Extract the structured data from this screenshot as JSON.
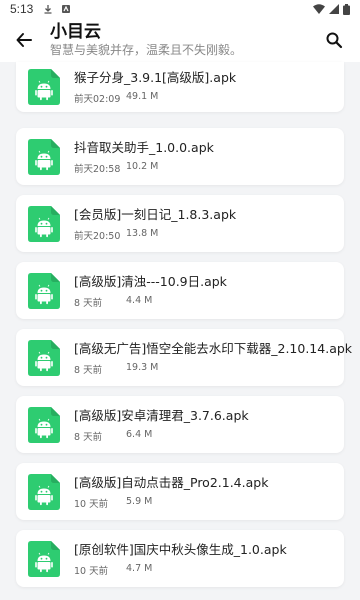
{
  "status": {
    "time": "5:13"
  },
  "header": {
    "title": "小目云",
    "subtitle": "智慧与美貌并存，温柔且不失刚毅。"
  },
  "colors": {
    "apk_green": "#2ecc71",
    "background": "#f3f4f6"
  },
  "files": [
    {
      "name": "猴子分身_3.9.1[高级版].apk",
      "date": "前天02:09",
      "size": "49.1 M"
    },
    {
      "name": "抖音取关助手_1.0.0.apk",
      "date": "前天20:58",
      "size": "10.2 M"
    },
    {
      "name": "[会员版]一刻日记_1.8.3.apk",
      "date": "前天20:50",
      "size": "13.8 M"
    },
    {
      "name": "[高级版]清浊---10.9日.apk",
      "date": "8 天前",
      "size": "4.4 M"
    },
    {
      "name": "[高级无广告]悟空全能去水印下载器_2.10.14.apk",
      "date": "8 天前",
      "size": "19.3 M"
    },
    {
      "name": "[高级版]安卓清理君_3.7.6.apk",
      "date": "8 天前",
      "size": "6.4 M"
    },
    {
      "name": "[高级版]自动点击器_Pro2.1.4.apk",
      "date": "10 天前",
      "size": "5.9 M"
    },
    {
      "name": "[原创软件]国庆中秋头像生成_1.0.apk",
      "date": "10 天前",
      "size": "4.7 M"
    }
  ]
}
